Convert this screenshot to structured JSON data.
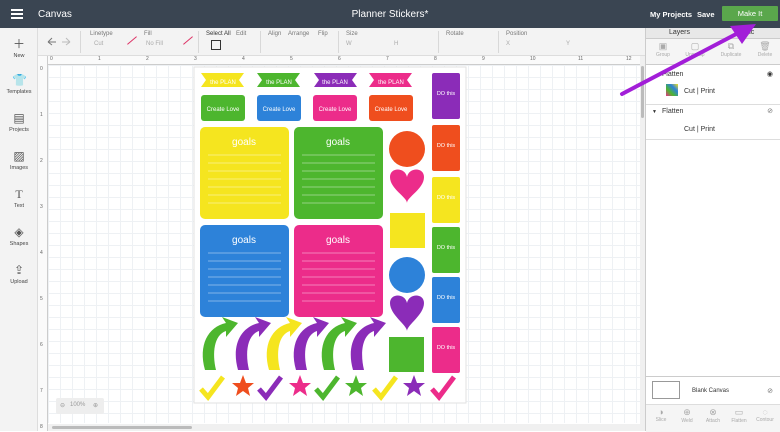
{
  "app": {
    "menu_icon": "hamburger-icon",
    "name": "Canvas",
    "document_title": "Planner Stickers*",
    "my_projects": "My Projects",
    "save": "Save",
    "make_it": "Make It",
    "accent": "#5aa74c"
  },
  "toolbar": {
    "linetype_label": "Linetype",
    "linetype_value": "Cut",
    "fill_label": "Fill",
    "fill_value": "No Fill",
    "select_all": "Select All",
    "edit": "Edit",
    "align": "Align",
    "arrange": "Arrange",
    "flip": "Flip",
    "size": "Size",
    "size_w": "W",
    "size_h": "H",
    "rotate": "Rotate",
    "position": "Position",
    "pos_x": "X",
    "pos_y": "Y"
  },
  "left_tools": [
    {
      "label": "New",
      "icon": "plus-icon"
    },
    {
      "label": "Templates",
      "icon": "shirt-icon"
    },
    {
      "label": "Projects",
      "icon": "book-icon"
    },
    {
      "label": "Images",
      "icon": "image-icon"
    },
    {
      "label": "Text",
      "icon": "text-icon"
    },
    {
      "label": "Shapes",
      "icon": "shapes-icon"
    },
    {
      "label": "Upload",
      "icon": "upload-icon"
    }
  ],
  "rulers": {
    "h": [
      "0",
      "1",
      "2",
      "3",
      "4",
      "5",
      "6",
      "7",
      "8",
      "9",
      "10",
      "11",
      "12"
    ],
    "v": [
      "0",
      "1",
      "2",
      "3",
      "4",
      "5",
      "6",
      "7",
      "8"
    ]
  },
  "zoom": {
    "level": "100%"
  },
  "panel": {
    "tab_layers": "Layers",
    "tab_sync": "Sync",
    "actions": [
      "Group",
      "Ungroup",
      "Duplicate",
      "Delete"
    ],
    "layer1_title": "Flatten",
    "layer1_sub": "Cut | Print",
    "layer2_title": "Flatten",
    "layer2_sub": "Cut | Print",
    "blank_canvas": "Blank Canvas",
    "bottom_actions": [
      "Slice",
      "Weld",
      "Attach",
      "Flatten",
      "Contour"
    ]
  },
  "stickers": {
    "flag_text": "the PLAN",
    "create_text": "Create Love",
    "goals": "goals",
    "do_this": "DO this",
    "colors": {
      "yellow": "#f5e51f",
      "green": "#4db62e",
      "blue": "#2d82d9",
      "pink": "#ec2c8a",
      "purple": "#8b2cb8",
      "orange": "#ef4e1e"
    }
  }
}
